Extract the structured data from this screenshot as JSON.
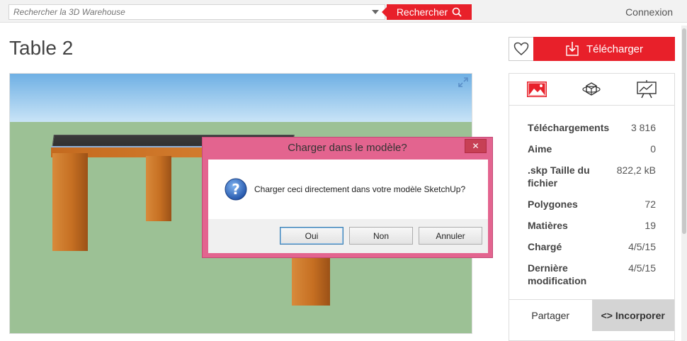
{
  "topbar": {
    "search_placeholder": "Rechercher la 3D Warehouse",
    "search_button": "Rechercher",
    "login": "Connexion"
  },
  "model": {
    "title": "Table 2"
  },
  "actions": {
    "download": "Télécharger"
  },
  "stats": [
    {
      "label": "Téléchargements",
      "value": "3 816"
    },
    {
      "label": "Aime",
      "value": "0"
    },
    {
      "label": ".skp Taille du fichier",
      "value": "822,2 kB"
    },
    {
      "label": "Polygones",
      "value": "72"
    },
    {
      "label": "Matières",
      "value": "19"
    },
    {
      "label": "Chargé",
      "value": "4/5/15"
    },
    {
      "label": "Dernière modification",
      "value": "4/5/15"
    }
  ],
  "share": {
    "share_tab": "Partager",
    "embed_tab": "<> Incorporer"
  },
  "dialog": {
    "title": "Charger dans le modèle?",
    "close": "✕",
    "message": "Charger ceci directement dans votre modèle SketchUp?",
    "yes": "Oui",
    "no": "Non",
    "cancel": "Annuler"
  },
  "colors": {
    "brand": "#e8202a",
    "dialog_frame": "#e3648f"
  },
  "icons": {
    "search": "search-icon",
    "favorite": "heart-icon",
    "download": "download-icon",
    "image_view": "image-icon",
    "orbit_view": "orbit-3d-icon",
    "presentation_view": "presentation-icon",
    "expand": "expand-icon",
    "question": "question-icon"
  }
}
